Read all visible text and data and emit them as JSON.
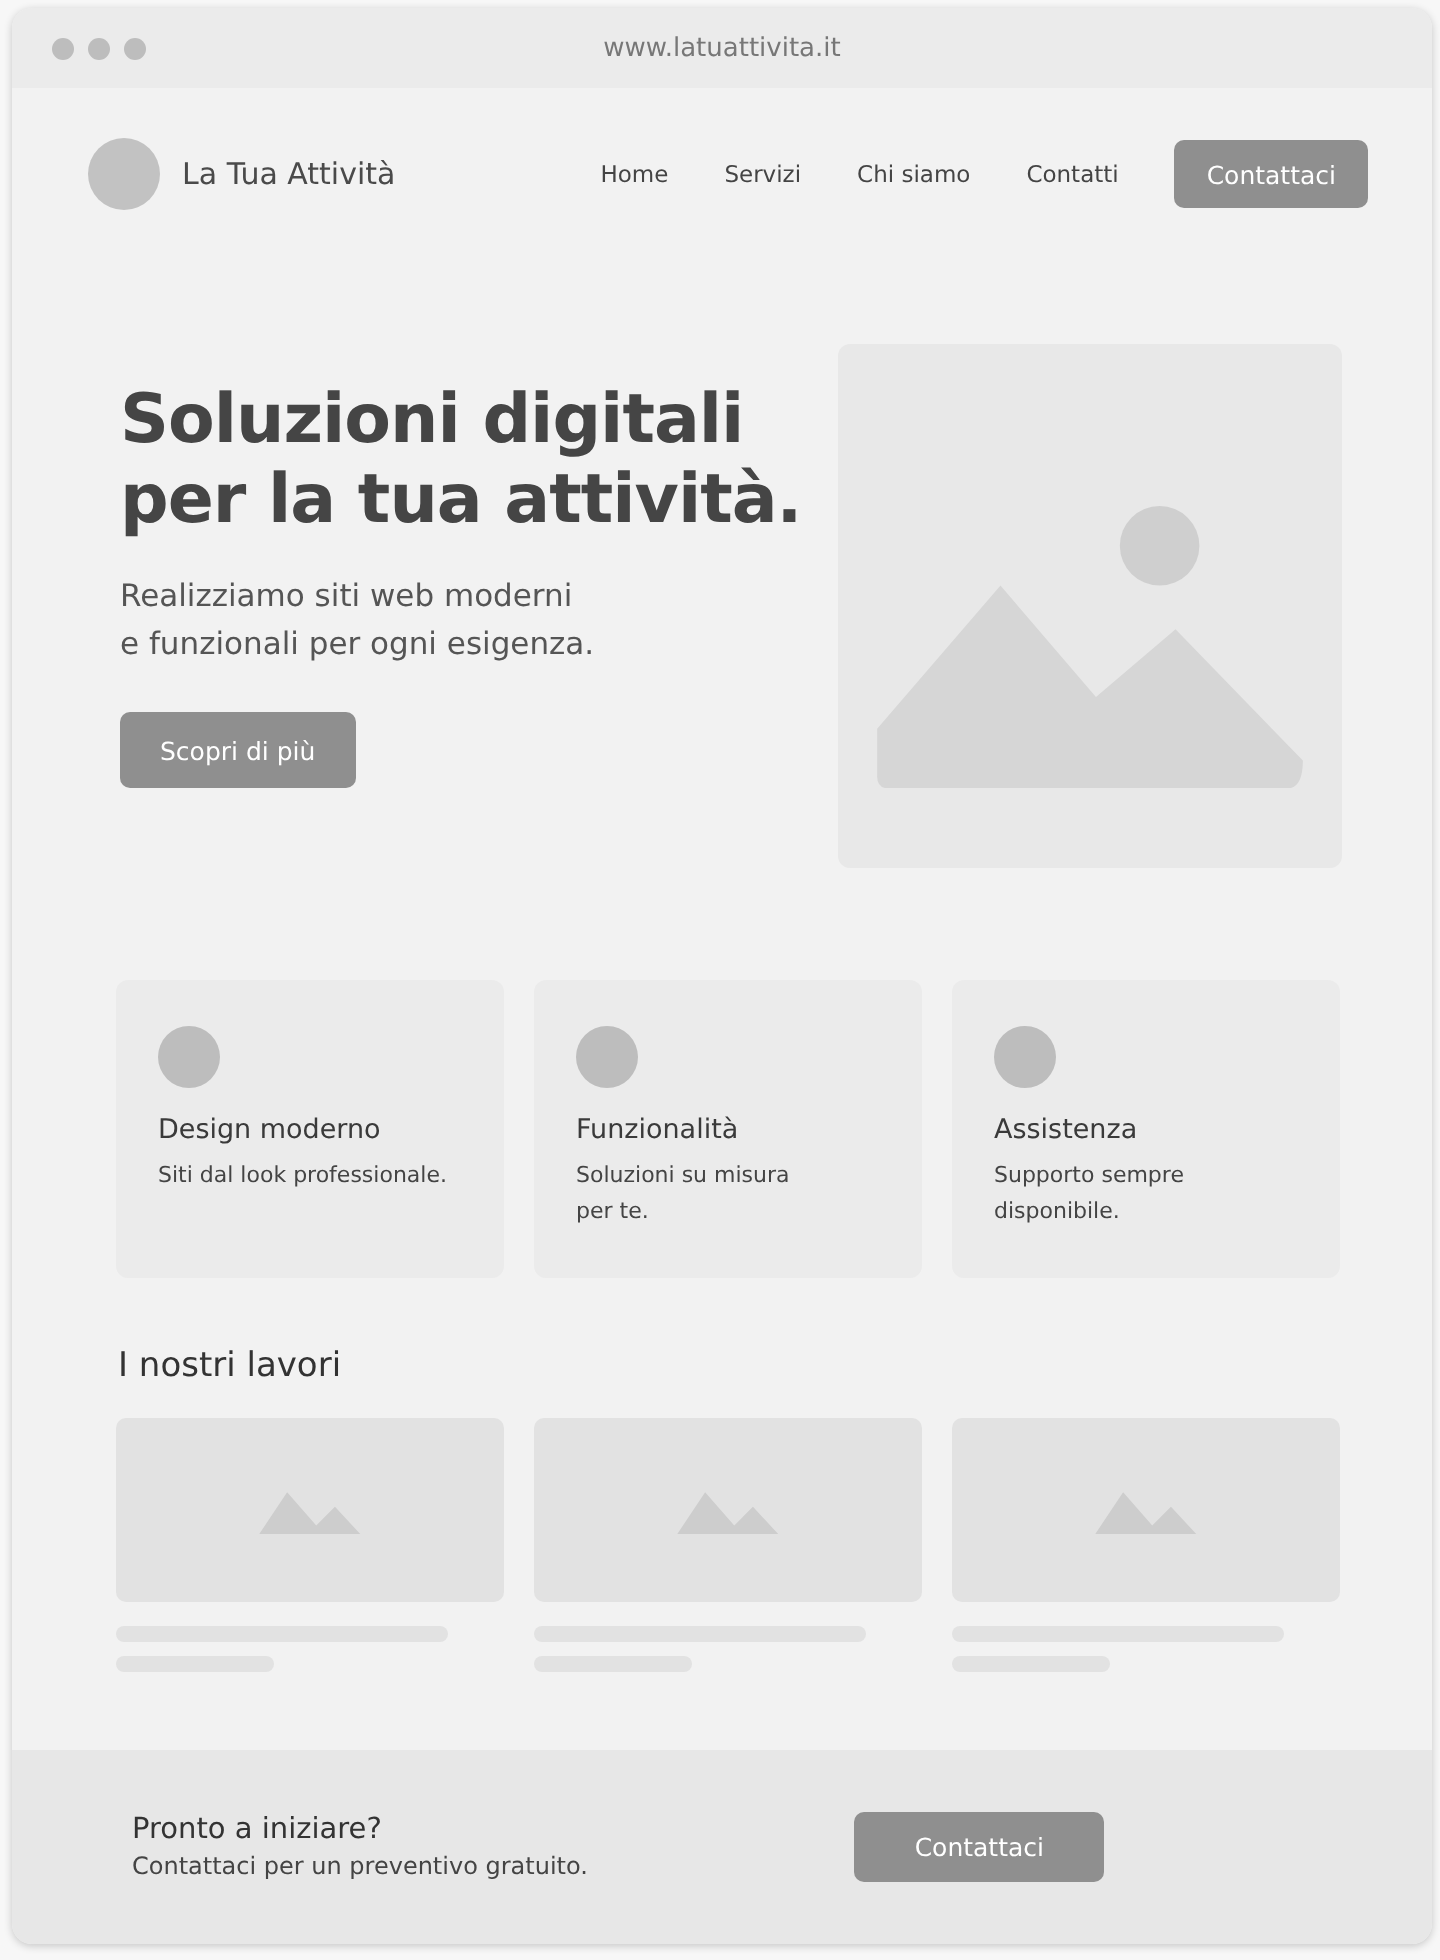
{
  "browser": {
    "url": "www.latuattivita.it"
  },
  "header": {
    "brand": "La Tua Attività",
    "nav": [
      "Home",
      "Servizi",
      "Chi siamo",
      "Contatti"
    ],
    "cta": "Contattaci"
  },
  "hero": {
    "title_lines": [
      "Soluzioni digitali",
      "per la tua attività."
    ],
    "subtitle_lines": [
      "Realizziamo siti web moderni",
      "e funzionali per ogni esigenza."
    ],
    "button": "Scopri di più"
  },
  "features": [
    {
      "title": "Design moderno",
      "text_lines": [
        "Siti dal look professionale."
      ]
    },
    {
      "title": "Funzionalità",
      "text_lines": [
        "Soluzioni su misura",
        "per te."
      ]
    },
    {
      "title": "Assistenza",
      "text_lines": [
        "Supporto sempre",
        "disponibile."
      ]
    }
  ],
  "works": {
    "title": "I nostri lavori",
    "items": [
      {
        "kind": "placeholder"
      },
      {
        "kind": "placeholder"
      },
      {
        "kind": "placeholder"
      }
    ]
  },
  "footer": {
    "title": "Pronto a iniziare?",
    "text": "Contattaci per un preventivo gratuito.",
    "button": "Contattaci"
  }
}
